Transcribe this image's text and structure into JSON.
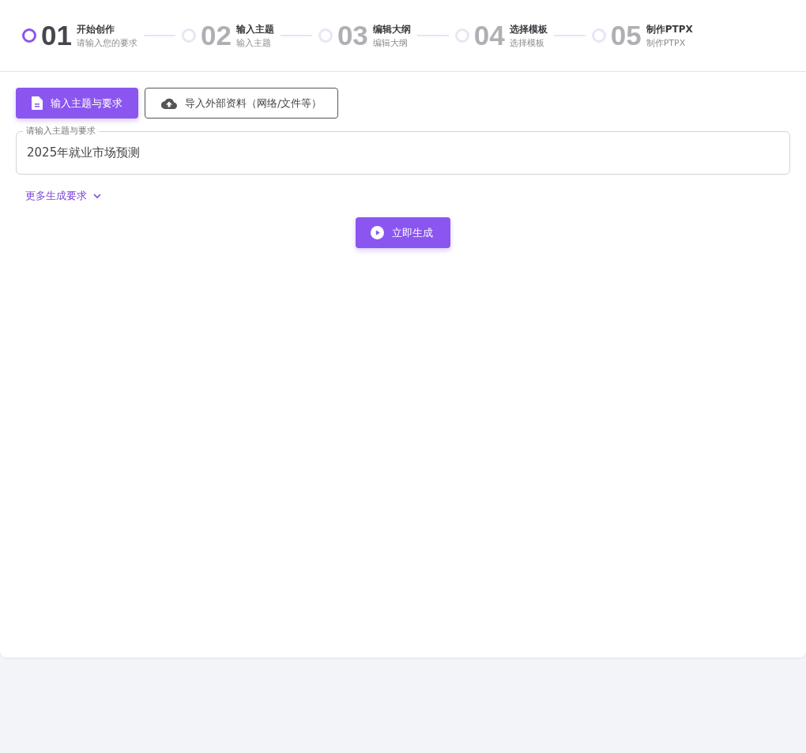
{
  "steps": [
    {
      "number": "01",
      "title": "开始创作",
      "subtitle": "请输入您的要求",
      "selected": true
    },
    {
      "number": "02",
      "title": "输入主题",
      "subtitle": "输入主题",
      "selected": false
    },
    {
      "number": "03",
      "title": "编辑大纲",
      "subtitle": "编辑大纲",
      "selected": false
    },
    {
      "number": "04",
      "title": "选择模板",
      "subtitle": "选择模板",
      "selected": false
    },
    {
      "number": "05",
      "title": "制作PTPX",
      "subtitle": "制作PTPX",
      "selected": false
    }
  ],
  "mode_tabs": [
    {
      "label": "输入主题与要求",
      "kind": "document",
      "selected": true
    },
    {
      "label": "导入外部资料（网络/文件等）",
      "kind": "upload",
      "selected": false
    }
  ],
  "topic_field": {
    "label": "请输入主题与要求",
    "value": "2025年就业市场预测"
  },
  "more_options": {
    "label": "更多生成要求",
    "expanded": false
  },
  "generate_button": {
    "label": "立即生成"
  }
}
